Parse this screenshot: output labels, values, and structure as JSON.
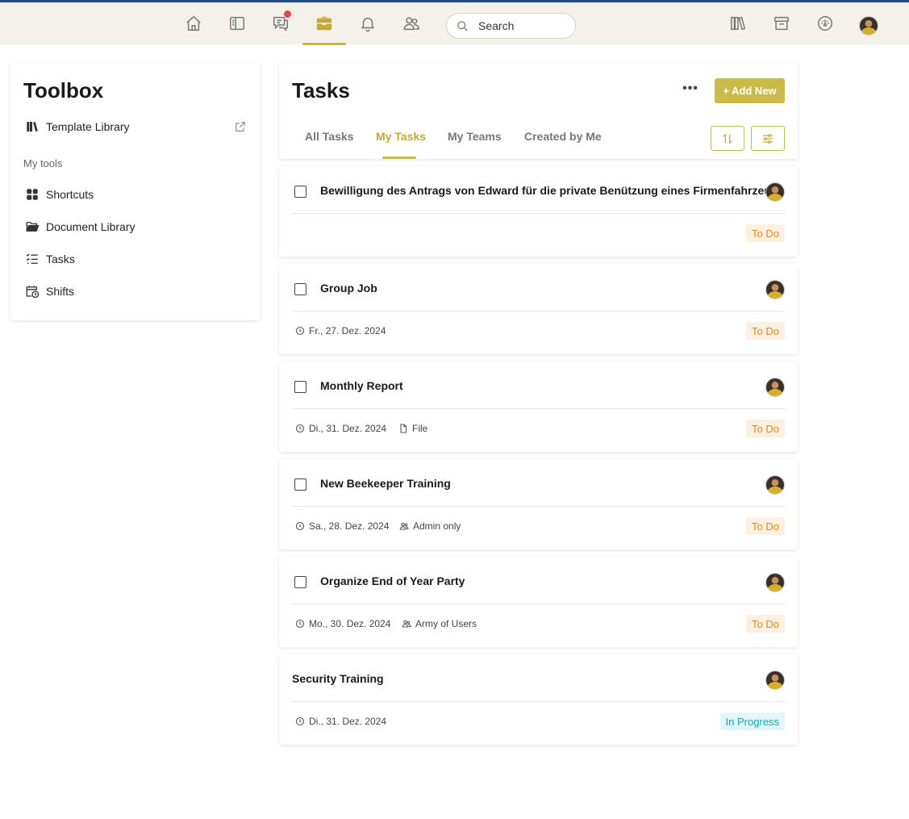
{
  "topbar": {
    "search_placeholder": "Search",
    "nav_icons": [
      "home-icon",
      "sidebar-panel-icon",
      "chat-icon",
      "toolbox-icon",
      "bell-icon",
      "people-icon"
    ],
    "right_icons": [
      "library-icon",
      "store-icon",
      "dashboard-icon"
    ],
    "active_nav": "toolbox-icon",
    "accent_color": "#c9ba4a",
    "notification_color": "#e84545"
  },
  "sidebar": {
    "title": "Toolbox",
    "template_library": "Template Library",
    "section_label": "My tools",
    "items": [
      {
        "label": "Shortcuts",
        "icon": "grid-icon"
      },
      {
        "label": "Document Library",
        "icon": "folder-open-icon"
      },
      {
        "label": "Tasks",
        "icon": "checklist-icon"
      },
      {
        "label": "Shifts",
        "icon": "calendar-clock-icon"
      }
    ]
  },
  "tasks": {
    "title": "Tasks",
    "add_label": "+ Add New",
    "more_label": "•••",
    "tabs": [
      "All Tasks",
      "My Tasks",
      "My Teams",
      "Created by Me"
    ],
    "active_tab": "My Tasks",
    "items": [
      {
        "title": "Bewilligung des Antrags von Edward für die private Benützung eines Firmenfahrzeugs",
        "date": "",
        "extra": "",
        "extra_icon": "",
        "status": "To Do",
        "checkbox": true
      },
      {
        "title": "Group Job",
        "date": "Fr., 27. Dez. 2024",
        "extra": "",
        "extra_icon": "",
        "status": "To Do",
        "checkbox": true
      },
      {
        "title": "Monthly Report",
        "date": "Di., 31. Dez. 2024",
        "extra": "File",
        "extra_icon": "file-icon",
        "status": "To Do",
        "checkbox": true
      },
      {
        "title": "New Beekeeper Training",
        "date": "Sa., 28. Dez. 2024",
        "extra": "Admin only",
        "extra_icon": "group-icon",
        "status": "To Do",
        "checkbox": true
      },
      {
        "title": "Organize End of Year Party",
        "date": "Mo., 30. Dez. 2024",
        "extra": "Army of Users",
        "extra_icon": "group-icon",
        "status": "To Do",
        "checkbox": true
      },
      {
        "title": "Security Training",
        "date": "Di., 31. Dez. 2024",
        "extra": "",
        "extra_icon": "",
        "status": "In Progress",
        "checkbox": false
      }
    ]
  }
}
